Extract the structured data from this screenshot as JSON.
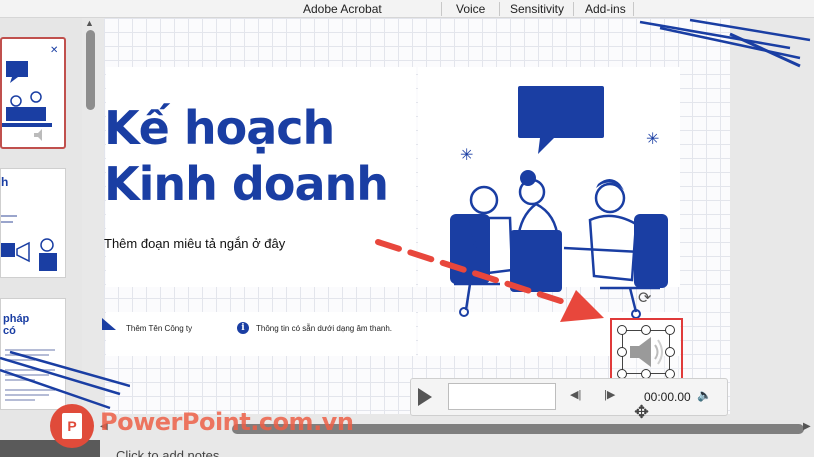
{
  "ribbon": {
    "tabs": [
      {
        "label": "Adobe Acrobat"
      },
      {
        "label": "Voice"
      },
      {
        "label": "Sensitivity"
      },
      {
        "label": "Add-ins"
      }
    ]
  },
  "thumbnails": {
    "slide2": {
      "title": "h"
    },
    "slide3": {
      "title_line1": "pháp",
      "title_line2": "có"
    }
  },
  "slide": {
    "title_line1": "Kế hoạch",
    "title_line2": "Kinh doanh",
    "subtitle": "Thêm đoạn miêu tả ngắn ở đây",
    "company": "Thêm Tên Công ty",
    "info_text": "Thông tin có sẵn dưới dạng âm thanh.",
    "info_icon_glyph": "i"
  },
  "audio_player": {
    "time": "00:00.00"
  },
  "notes": {
    "placeholder": "Click to add notes"
  },
  "watermark": {
    "text": "PowerPoint.com.vn",
    "logo_letter": "P"
  },
  "colors": {
    "title_blue": "#1a3ea3",
    "highlight_red": "#e03a3a",
    "arrow_red": "#e8473c"
  }
}
